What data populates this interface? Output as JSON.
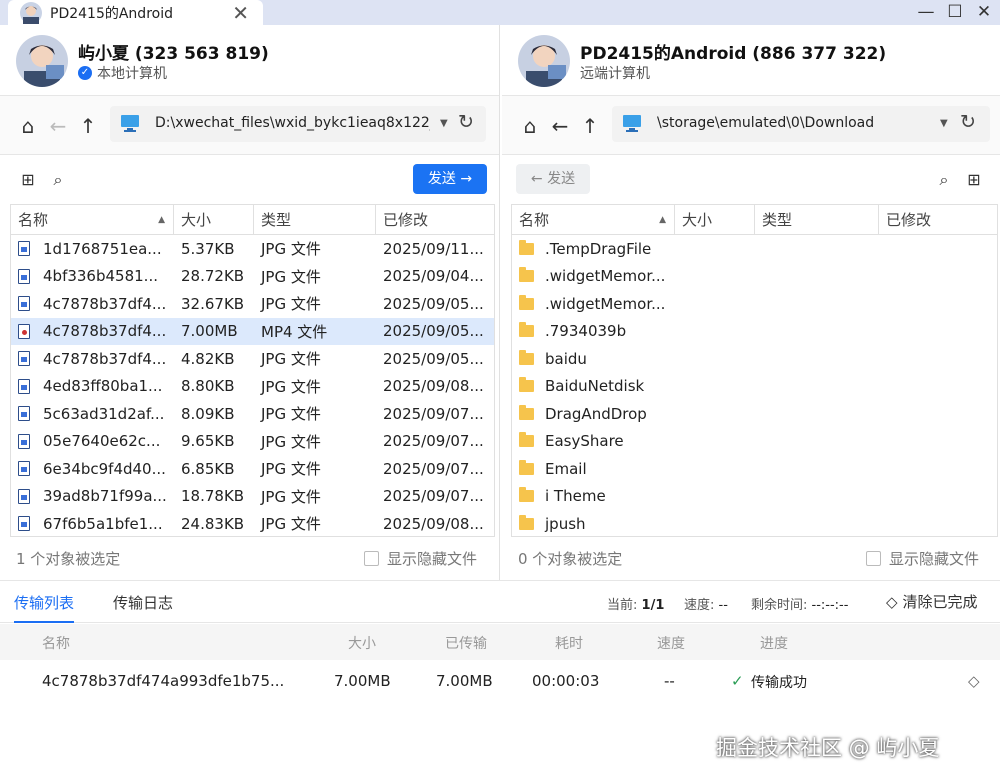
{
  "window": {
    "tab_title": "PD2415的Android",
    "close_tab": "✕",
    "min": "—",
    "max": "☐",
    "close": "✕"
  },
  "left": {
    "user_name": "屿小夏 (323 563 819)",
    "user_sub": "本地计算机",
    "path": "D:\\xwechat_files\\wxid_bykc1ieaq8x122_",
    "send_label": "发送 →",
    "columns": [
      "名称",
      "大小",
      "类型",
      "已修改"
    ],
    "files": [
      {
        "name": "1d1768751ea...",
        "size": "5.37KB",
        "type": "JPG 文件",
        "modified": "2025/09/11..."
      },
      {
        "name": "4bf336b4581...",
        "size": "28.72KB",
        "type": "JPG 文件",
        "modified": "2025/09/04..."
      },
      {
        "name": "4c7878b37df4...",
        "size": "32.67KB",
        "type": "JPG 文件",
        "modified": "2025/09/05..."
      },
      {
        "name": "4c7878b37df4...",
        "size": "7.00MB",
        "type": "MP4 文件",
        "modified": "2025/09/05...",
        "selected": true
      },
      {
        "name": "4c7878b37df4...",
        "size": "4.82KB",
        "type": "JPG 文件",
        "modified": "2025/09/05..."
      },
      {
        "name": "4ed83ff80ba1...",
        "size": "8.80KB",
        "type": "JPG 文件",
        "modified": "2025/09/08..."
      },
      {
        "name": "5c63ad31d2af...",
        "size": "8.09KB",
        "type": "JPG 文件",
        "modified": "2025/09/07..."
      },
      {
        "name": "05e7640e62c...",
        "size": "9.65KB",
        "type": "JPG 文件",
        "modified": "2025/09/07..."
      },
      {
        "name": "6e34bc9f4d40...",
        "size": "6.85KB",
        "type": "JPG 文件",
        "modified": "2025/09/07..."
      },
      {
        "name": "39ad8b71f99a...",
        "size": "18.78KB",
        "type": "JPG 文件",
        "modified": "2025/09/07..."
      },
      {
        "name": "67f6b5a1bfe1...",
        "size": "24.83KB",
        "type": "JPG 文件",
        "modified": "2025/09/08..."
      }
    ],
    "status": "1 个对象被选定",
    "show_hidden": "显示隐藏文件"
  },
  "right": {
    "user_name": "PD2415的Android (886 377 322)",
    "user_sub": "远端计算机",
    "path": "\\storage\\emulated\\0\\Download",
    "send_label": "← 发送",
    "columns": [
      "名称",
      "大小",
      "类型",
      "已修改"
    ],
    "folders": [
      ".TempDragFile",
      ".widgetMemor...",
      ".widgetMemor...",
      ".7934039b",
      "baidu",
      "BaiduNetdisk",
      "DragAndDrop",
      "EasyShare",
      "Email",
      "i Theme",
      "jpush"
    ],
    "status": "0 个对象被选定",
    "show_hidden": "显示隐藏文件"
  },
  "transfer": {
    "tab_list": "传输列表",
    "tab_log": "传输日志",
    "current_label": "当前:",
    "current_value": "1/1",
    "speed_label": "速度:",
    "speed_value": "--",
    "remaining_label": "剩余时间:",
    "remaining_value": "--:--:--",
    "clear_label": "清除已完成",
    "columns": [
      "名称",
      "大小",
      "已传输",
      "耗时",
      "速度",
      "进度"
    ],
    "row": {
      "name": "4c7878b37df474a993dfe1b75...",
      "size": "7.00MB",
      "transferred": "7.00MB",
      "elapsed": "00:00:03",
      "speed": "--",
      "progress": "传输成功"
    }
  },
  "watermark": "掘金技术社区 @ 屿小夏"
}
